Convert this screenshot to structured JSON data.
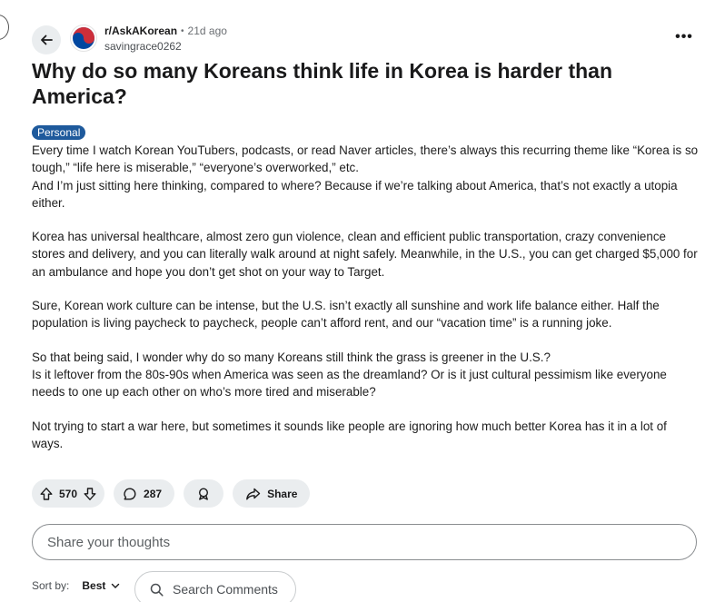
{
  "post": {
    "subreddit": "r/AskAKorean",
    "separator": "•",
    "age": "21d ago",
    "author": "savingrace0262",
    "more_label": "•••",
    "title": "Why do so many Koreans think life in Korea is harder than America?",
    "flair": "Personal",
    "paragraphs": [
      "Every time I watch Korean YouTubers, podcasts, or read Naver articles, there’s always this recurring theme like “Korea is so tough,” “life here is miserable,” “everyone’s overworked,” etc.",
      "And I’m just sitting here thinking, compared to where? Because if we’re talking about America, that’s not exactly a utopia either.",
      "Korea has universal healthcare, almost zero gun violence, clean and efficient public transportation, crazy convenience stores and delivery, and you can literally walk around at night safely. Meanwhile, in the U.S., you can get charged $5,000 for an ambulance and hope you don’t get shot on your way to Target.",
      "Sure, Korean work culture can be intense, but the U.S. isn’t exactly all sunshine and work life balance either. Half the population is living paycheck to paycheck, people can’t afford rent, and our “vacation time” is a running joke.",
      "So that being said, I wonder why do so many Koreans still think the grass is greener in the U.S.?",
      "Is it leftover from the 80s-90s when America was seen as the dreamland? Or is it just cultural pessimism like everyone needs to one up each other on who’s more tired and miserable?",
      "Not trying to start a war here, but sometimes it sounds like people are ignoring how much better Korea has it in a lot of ways."
    ]
  },
  "actions": {
    "votes": "570",
    "comments": "287",
    "share": "Share"
  },
  "comment_box": {
    "placeholder": "Share your thoughts"
  },
  "sort": {
    "label": "Sort by:",
    "value": "Best"
  },
  "search_comments": {
    "placeholder": "Search Comments"
  },
  "colors": {
    "flair_bg": "#1e5a9c",
    "pill_bg": "#eaedef",
    "avatar_red": "#cd2e3a",
    "avatar_blue": "#0047a0"
  },
  "icons": [
    "arrow-left-icon",
    "korea-flag-icon",
    "more-icon",
    "upvote-icon",
    "downvote-icon",
    "comment-icon",
    "award-icon",
    "share-icon",
    "chevron-down-icon",
    "search-icon"
  ]
}
